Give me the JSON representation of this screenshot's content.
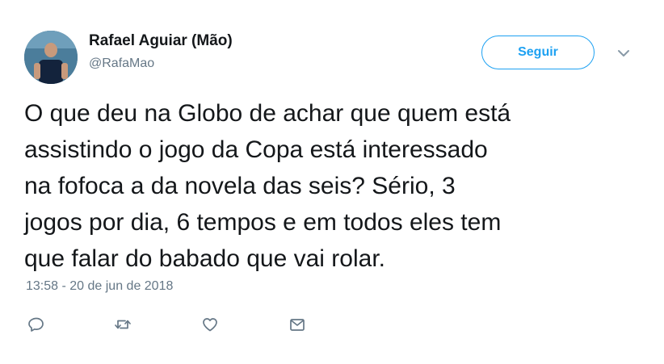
{
  "author": {
    "name": "Rafael Aguiar (Mão)",
    "handle": "@RafaMao"
  },
  "follow_button": {
    "label": "Seguir"
  },
  "tweet": {
    "lines": [
      "O que deu na Globo de achar que quem está",
      "assistindo o jogo da Copa está interessado",
      "na fofoca a da novela das seis? Sério, 3",
      "jogos por dia, 6 tempos e em todos eles tem",
      "que falar do babado que vai rolar."
    ],
    "timestamp": "13:58 - 20 de jun de 2018"
  },
  "actions": {
    "reply_icon": "reply-icon",
    "retweet_icon": "retweet-icon",
    "like_icon": "heart-icon",
    "dm_icon": "envelope-icon"
  },
  "colors": {
    "accent": "#1da1f2",
    "text": "#14171a",
    "muted": "#657786"
  }
}
